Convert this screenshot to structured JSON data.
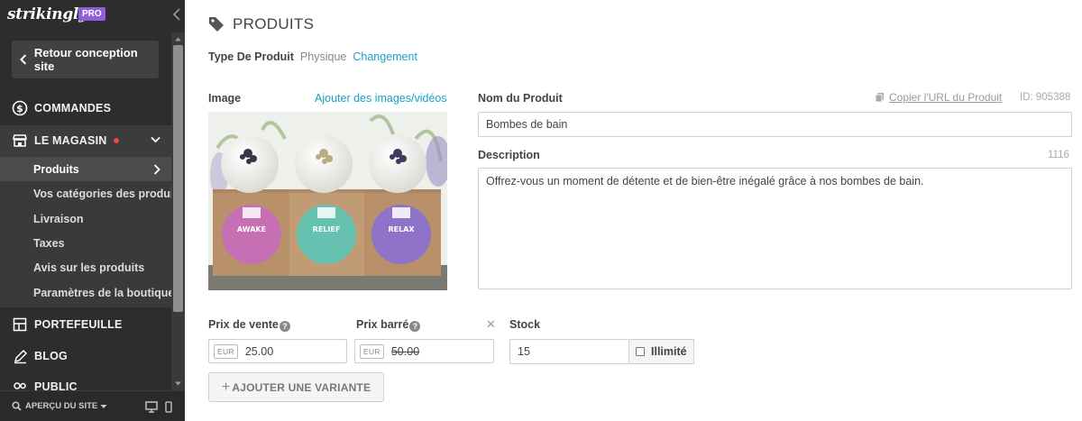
{
  "sidebar": {
    "logo": "strikingly",
    "badge": "PRO",
    "back_label": "Retour conception site",
    "nav": {
      "commandes": "COMMANDES",
      "magasin": "LE MAGASIN",
      "portefeuille": "PORTEFEUILLE",
      "blog": "BLOG",
      "public": "PUBLIC"
    },
    "sub_items": [
      "Produits",
      "Vos catégories des produits",
      "Livraison",
      "Taxes",
      "Avis sur les produits",
      "Paramètres de la boutique"
    ],
    "preview_label": "APERÇU DU SITE"
  },
  "main": {
    "title": "PRODUITS",
    "type_label": "Type De Produit",
    "type_value": "Physique",
    "type_change": "Changement",
    "image_label": "Image",
    "add_media": "Ajouter des images/vidéos",
    "name_label": "Nom du Produit",
    "copy_url": "Copier l'URL du Produit",
    "product_id": "ID: 905388",
    "name_value": "Bombes de bain",
    "description_label": "Description",
    "description_count": "1116",
    "description_value": "Offrez-vous un moment de détente et de bien-être inégalé grâce à nos bombes de bain.",
    "sale_price_label": "Prix de vente",
    "strike_price_label": "Prix barré",
    "stock_label": "Stock",
    "currency": "EUR",
    "sale_price": "25.00",
    "strike_price": "50.00",
    "stock_value": "15",
    "unlimited_label": "Illimité",
    "add_variant": "AJOUTER UNE VARIANTE",
    "help_glyph": "?",
    "close_glyph": "✕",
    "product_labels": [
      "AWAKE",
      "RELIEF",
      "RELAX"
    ]
  },
  "colors": {
    "sidebar_bg": "#2d2d2d",
    "accent_link": "#1a9fc7",
    "pro_badge": "#8e5fd8"
  }
}
